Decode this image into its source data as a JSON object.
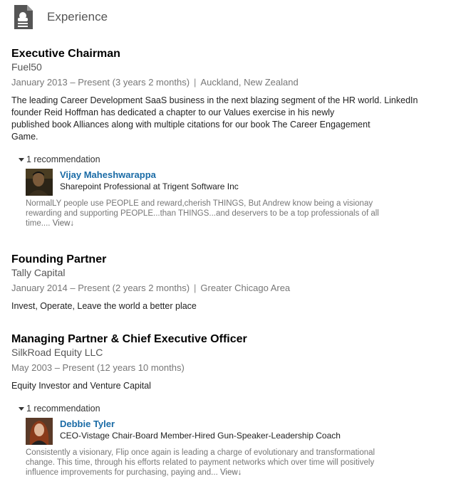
{
  "section": {
    "title": "Experience",
    "icon": "document-icon"
  },
  "positions": [
    {
      "title": "Executive Chairman",
      "company": "Fuel50",
      "dates": "January 2013 – Present (3 years 2 months)",
      "separator": "|",
      "location": "Auckland, New Zealand",
      "description_lines": [
        "The leading Career Development SaaS business in the next blazing segment of the HR world. LinkedIn",
        "founder Reid Hoffman has dedicated a chapter to our Values exercise in his newly",
        "published book Alliances along with multiple citations for our book The Career Engagement",
        "Game."
      ],
      "recommendation": {
        "toggle_label": "1 recommendation",
        "name": "Vijay Maheshwarappa",
        "role": "Sharepoint Professional at Trigent Software Inc",
        "text_lines": [
          "NormalLY people use PEOPLE and reward,cherish THINGS, But Andrew know being a visionay",
          "rewarding and supporting PEOPLE...than THINGS...and deservers to be a top professionals of all",
          "time.... "
        ],
        "view_label": "View↓"
      }
    },
    {
      "title": "Founding Partner",
      "company": "Tally Capital",
      "dates": "January 2014 – Present (2 years 2 months)",
      "separator": "|",
      "location": "Greater Chicago Area",
      "description": "Invest, Operate, Leave the world a better place"
    },
    {
      "title": "Managing Partner & Chief Executive Officer",
      "company": "SilkRoad Equity LLC",
      "dates": "May 2003 – Present (12 years 10 months)",
      "description": "Equity Investor and Venture Capital",
      "recommendation": {
        "toggle_label": "1 recommendation",
        "name": "Debbie Tyler",
        "role": "CEO-Vistage Chair-Board Member-Hired Gun-Speaker-Leadership Coach",
        "text_lines": [
          "Consistently a visionary, Flip once again is leading a charge of evolutionary and transformational",
          "change. This time, through his efforts related to payment networks which over time will positively",
          "influence improvements for purchasing, paying and... "
        ],
        "view_label": "View↓"
      }
    }
  ],
  "colors": {
    "link": "#1a6ba6",
    "title": "#000000",
    "muted": "#777777"
  }
}
